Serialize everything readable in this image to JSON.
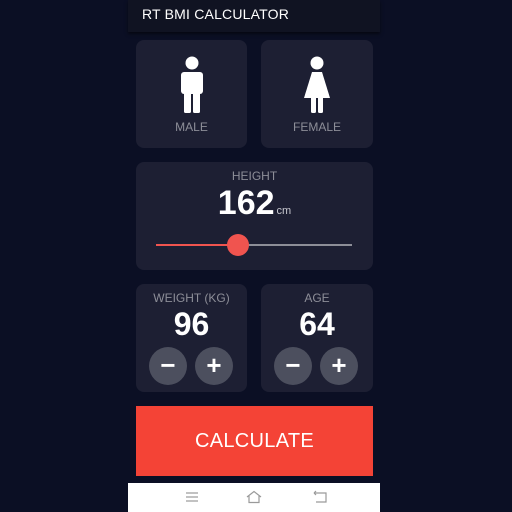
{
  "app": {
    "title": "RT BMI CALCULATOR"
  },
  "gender": {
    "male_label": "MALE",
    "female_label": "FEMALE",
    "male_icon": "male-person-icon",
    "female_icon": "female-person-icon"
  },
  "height": {
    "label": "HEIGHT",
    "value": "162",
    "unit": "cm",
    "slider_fraction": 0.42
  },
  "weight": {
    "label": "WEIGHT (KG)",
    "value": "96",
    "minus": "−",
    "plus": "+"
  },
  "age": {
    "label": "AGE",
    "value": "64",
    "minus": "−",
    "plus": "+"
  },
  "calculate": {
    "label": "CALCULATE"
  },
  "colors": {
    "background": "#0b0f24",
    "card": "#1d1f33",
    "accent": "#f44336",
    "muted_text": "#8d8e98"
  },
  "navbar": {
    "icons": [
      "menu-icon",
      "home-icon",
      "back-icon"
    ]
  }
}
